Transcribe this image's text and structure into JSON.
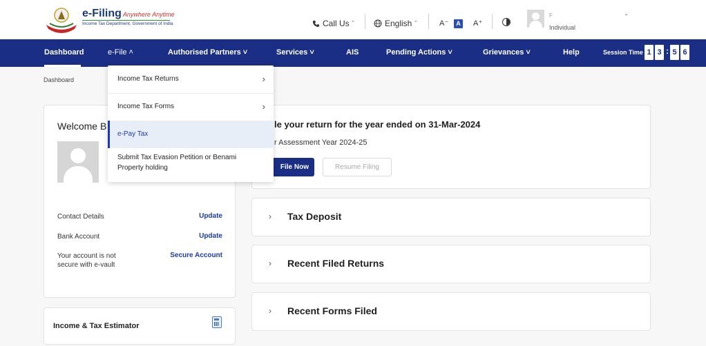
{
  "header": {
    "brand_title": "e-Filing",
    "brand_tagline": "Anywhere Anytime",
    "brand_subtitle": "Income Tax Department, Government of India",
    "call_us": "Call Us",
    "language": "English",
    "font_decrease": "A⁻",
    "font_normal": "A",
    "font_increase": "A⁺",
    "user_initial": "F",
    "user_role": "Individual"
  },
  "nav": {
    "items": [
      {
        "label": "Dashboard"
      },
      {
        "label": "e-File ˄"
      },
      {
        "label": "Authorised Partners ˅"
      },
      {
        "label": "Services ˅"
      },
      {
        "label": "AIS"
      },
      {
        "label": "Pending Actions ˅"
      },
      {
        "label": "Grievances ˅"
      },
      {
        "label": "Help"
      }
    ],
    "session_label": "Session Time",
    "session_digits": [
      "1",
      "3",
      "5",
      "6"
    ],
    "session_colon": ":"
  },
  "breadcrumb": "Dashboard",
  "profile": {
    "welcome": "Welcome B",
    "name_fragment": "",
    "contact_label": "Contact Details",
    "contact_link": "Update",
    "bank_label": "Bank Account",
    "bank_link": "Update",
    "vault_label": "Your account is not secure with e-vault",
    "vault_link": "Secure Account"
  },
  "estimator": {
    "label": "Income & Tax Estimator"
  },
  "file_card": {
    "title": "le your return for the year ended on 31-Mar-2024",
    "subtitle": "r Assessment Year 2024-25",
    "file_now": "File Now",
    "resume": "Resume Filing"
  },
  "accordions": [
    {
      "title": "Tax Deposit"
    },
    {
      "title": "Recent Filed Returns"
    },
    {
      "title": "Recent Forms Filed"
    }
  ],
  "dropdown": {
    "items": [
      {
        "label": "Income Tax Returns"
      },
      {
        "label": "Income Tax Forms"
      },
      {
        "label": "e-Pay Tax"
      },
      {
        "label": "Submit Tax Evasion Petition or Benami Property holding"
      }
    ]
  },
  "colors": {
    "nav_bg": "#1a2e85",
    "accent": "#1a3ba8",
    "highlight_bg": "#e8eef8"
  },
  "icons": {
    "phone": "phone-icon",
    "globe": "globe-icon",
    "contrast": "contrast-icon",
    "calculator": "calculator-icon",
    "chevron": "chevron-right-icon"
  }
}
